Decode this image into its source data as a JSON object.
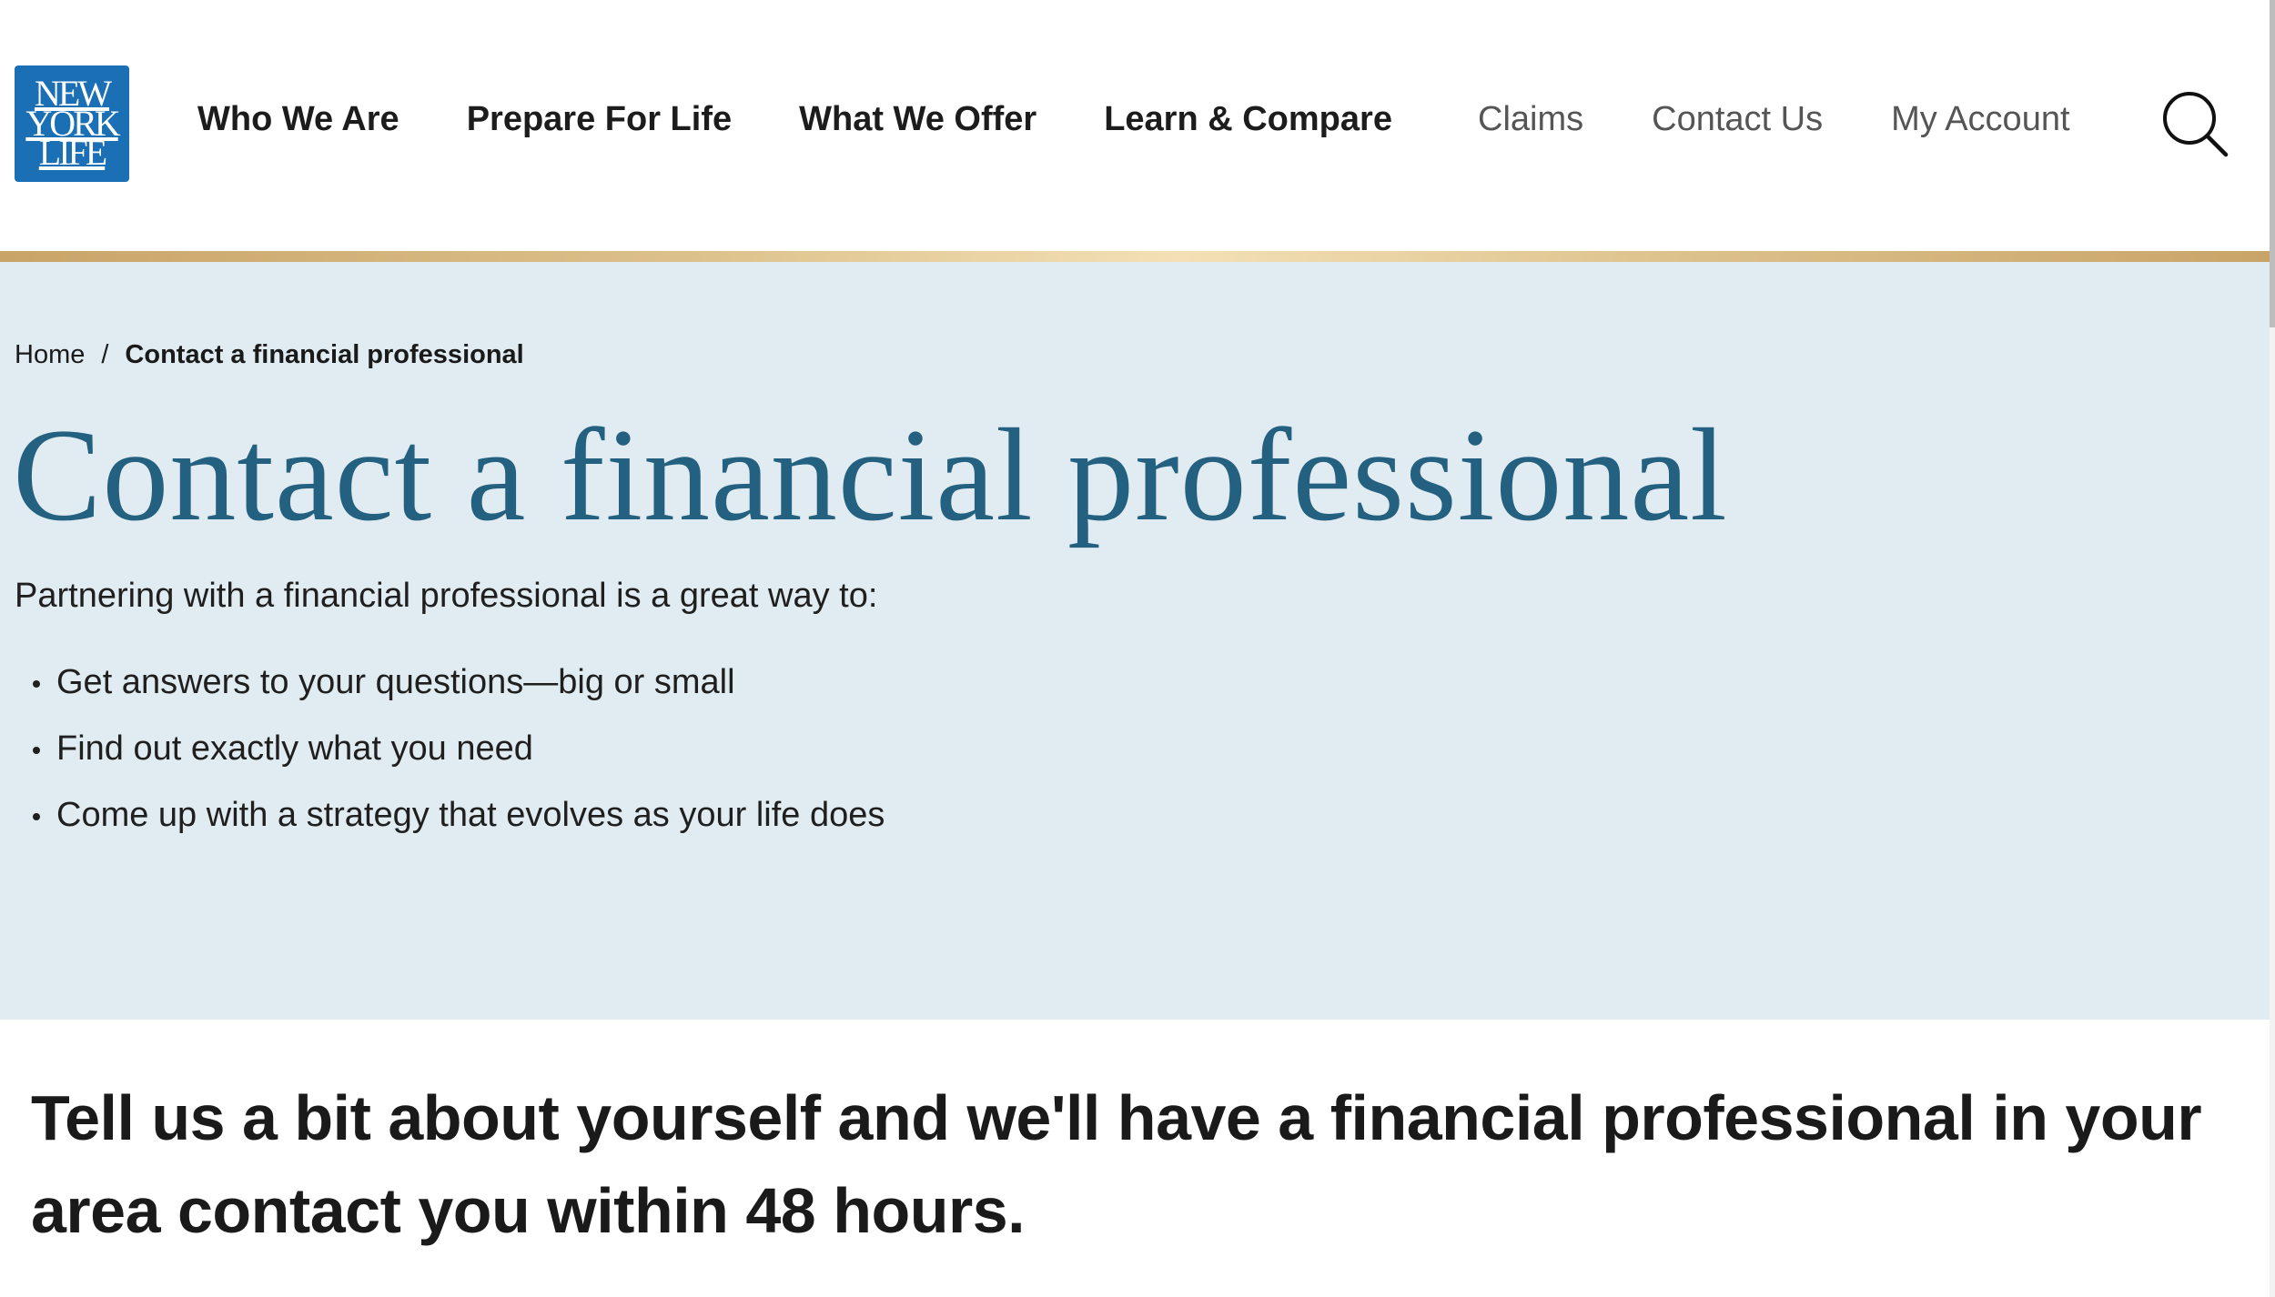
{
  "brand": {
    "logo_lines": [
      "New",
      "York",
      "Life"
    ],
    "color": "#1b6fb5",
    "accent_gold": "#d9bc85"
  },
  "nav": {
    "primary": [
      {
        "label": "Who We Are"
      },
      {
        "label": "Prepare For Life"
      },
      {
        "label": "What We Offer"
      },
      {
        "label": "Learn & Compare"
      }
    ],
    "secondary": [
      {
        "label": "Claims"
      },
      {
        "label": "Contact Us"
      },
      {
        "label": "My Account"
      }
    ],
    "search_icon": "search-icon"
  },
  "breadcrumb": {
    "home": "Home",
    "separator": "/",
    "current": "Contact a financial professional"
  },
  "hero": {
    "title": "Contact a financial professional",
    "intro": "Partnering with a financial professional is a great way to:",
    "bullets": [
      "Get answers to your questions—big or small",
      "Find out exactly what you need",
      "Come up with a strategy that evolves as your life does"
    ],
    "background": "#e0ecf2",
    "title_color": "#24607f"
  },
  "form_section": {
    "heading": "Tell us a bit about yourself and we'll have a financial professional in your area contact you within 48 hours."
  }
}
